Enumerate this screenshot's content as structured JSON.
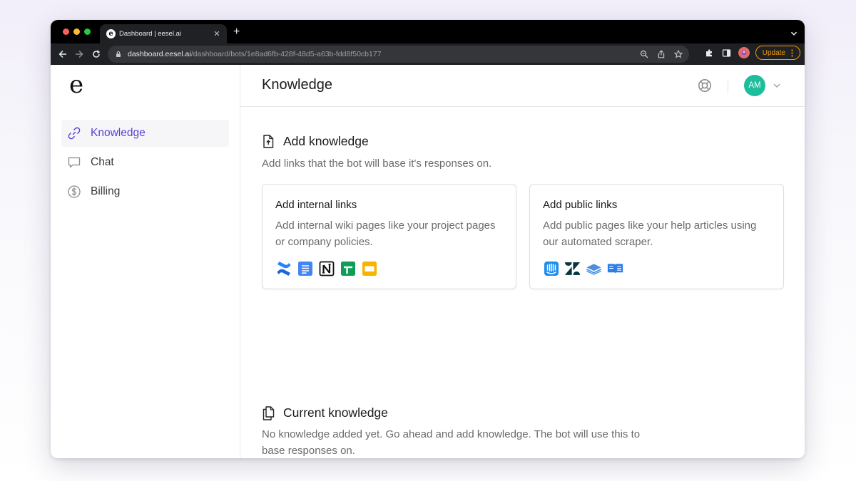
{
  "browser": {
    "tab_title": "Dashboard | eesel.ai",
    "tab_favicon": "e",
    "new_tab": "+",
    "close": "✕",
    "url_host": "dashboard.eesel.ai",
    "url_path": "/dashboard/bots/1e8ad6fb-428f-48d5-a63b-fdd8f50cb177",
    "update_label": "Update"
  },
  "app": {
    "logo": "e",
    "sidebar": {
      "items": [
        {
          "label": "Knowledge",
          "icon": "link-icon",
          "active": true
        },
        {
          "label": "Chat",
          "icon": "chat-icon",
          "active": false
        },
        {
          "label": "Billing",
          "icon": "dollar-icon",
          "active": false
        }
      ]
    },
    "header": {
      "title": "Knowledge",
      "avatar_initials": "AM"
    },
    "add_knowledge": {
      "title": "Add knowledge",
      "description": "Add links that the bot will base it's responses on.",
      "cards": [
        {
          "title": "Add internal links",
          "description": "Add internal wiki pages like your project pages or company policies.",
          "icons": [
            "confluence-icon",
            "google-docs-icon",
            "notion-icon",
            "google-sheets-icon",
            "google-slides-icon"
          ]
        },
        {
          "title": "Add public links",
          "description": "Add public pages like your help articles using our automated scraper.",
          "icons": [
            "intercom-icon",
            "zendesk-icon",
            "knowledge-base-icon",
            "help-docs-icon"
          ]
        }
      ]
    },
    "current_knowledge": {
      "title": "Current knowledge",
      "description": "No knowledge added yet. Go ahead and add knowledge. The bot will use this to base responses on."
    }
  },
  "colors": {
    "accent": "#5b3fd1",
    "avatar": "#1ebd9b",
    "update": "#f29900"
  }
}
